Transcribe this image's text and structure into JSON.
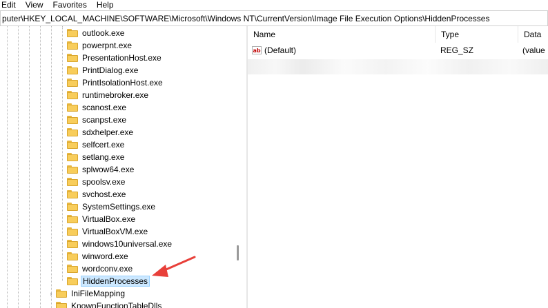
{
  "menu": {
    "items": [
      "Edit",
      "View",
      "Favorites",
      "Help"
    ]
  },
  "address": {
    "path": "puter\\HKEY_LOCAL_MACHINE\\SOFTWARE\\Microsoft\\Windows NT\\CurrentVersion\\Image File Execution Options\\HiddenProcesses"
  },
  "tree": {
    "items": [
      {
        "label": "outlook.exe"
      },
      {
        "label": "powerpnt.exe"
      },
      {
        "label": "PresentationHost.exe"
      },
      {
        "label": "PrintDialog.exe"
      },
      {
        "label": "PrintIsolationHost.exe"
      },
      {
        "label": "runtimebroker.exe"
      },
      {
        "label": "scanost.exe"
      },
      {
        "label": "scanpst.exe"
      },
      {
        "label": "sdxhelper.exe"
      },
      {
        "label": "selfcert.exe"
      },
      {
        "label": "setlang.exe"
      },
      {
        "label": "splwow64.exe"
      },
      {
        "label": "spoolsv.exe"
      },
      {
        "label": "svchost.exe"
      },
      {
        "label": "SystemSettings.exe"
      },
      {
        "label": "VirtualBox.exe"
      },
      {
        "label": "VirtualBoxVM.exe"
      },
      {
        "label": "windows10universal.exe"
      },
      {
        "label": "winword.exe"
      },
      {
        "label": "wordconv.exe"
      },
      {
        "label": "HiddenProcesses"
      }
    ],
    "parent_items": [
      {
        "label": "IniFileMapping"
      },
      {
        "label": "KnownFunctionTableDlls"
      }
    ],
    "selected": "HiddenProcesses"
  },
  "values": {
    "columns": [
      "Name",
      "Type",
      "Data"
    ],
    "rows": [
      {
        "name": "(Default)",
        "type": "REG_SZ",
        "data": "(value"
      }
    ]
  },
  "colors": {
    "selection_bg": "#cce8ff",
    "selection_border": "#99d1ff",
    "folder": "#f8cd5b",
    "arrow": "#e8403a"
  },
  "icons": {
    "folder": "folder-icon",
    "string_value": "ab-string-icon",
    "expander": "chevron-right-icon"
  }
}
